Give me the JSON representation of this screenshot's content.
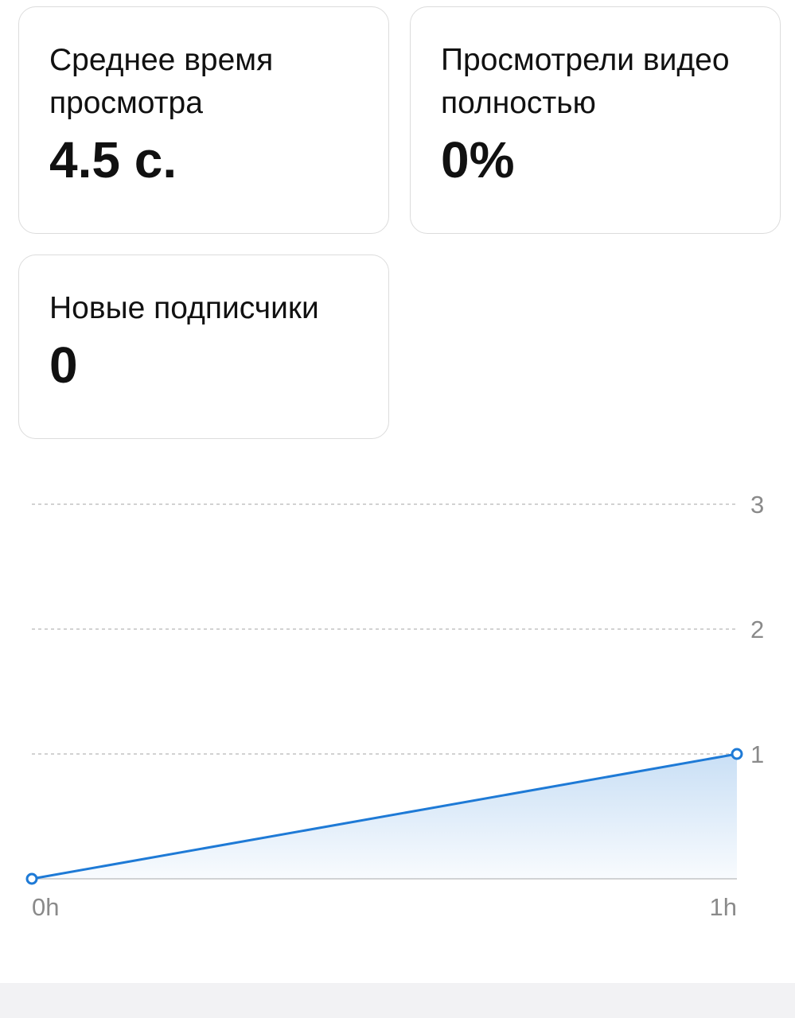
{
  "metrics": {
    "avg_watch_time": {
      "label": "Среднее время просмотра",
      "value": "4.5 с."
    },
    "watched_full": {
      "label": "Просмотрели видео полностью",
      "value": "0%"
    },
    "new_followers": {
      "label": "Новые подписчики",
      "value": "0"
    }
  },
  "chart_data": {
    "type": "area",
    "x": [
      "0h",
      "1h"
    ],
    "series": [
      {
        "values": [
          0,
          1
        ]
      }
    ],
    "y_ticks": [
      "1",
      "2",
      "3"
    ],
    "x_ticks": [
      "0h",
      "1h"
    ],
    "ylim": [
      0,
      3
    ],
    "grid": true,
    "y_axis_position": "right",
    "color": "#1e7ad6"
  }
}
